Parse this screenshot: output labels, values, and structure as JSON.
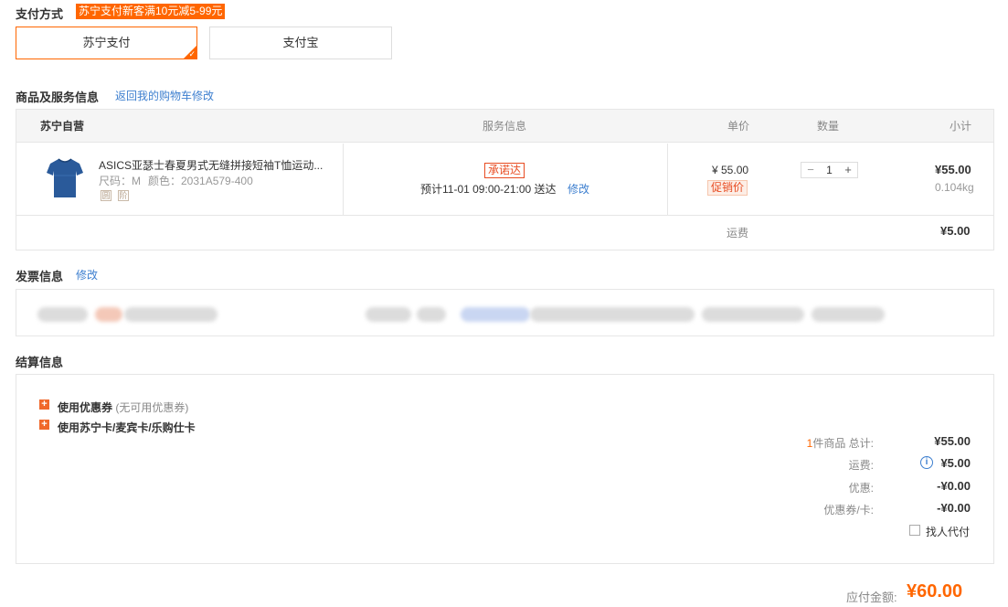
{
  "payment": {
    "title": "支付方式",
    "promo": "苏宁支付新客满10元减5-99元",
    "options": [
      {
        "label": "苏宁支付",
        "selected": true
      },
      {
        "label": "支付宝",
        "selected": false
      }
    ]
  },
  "goods": {
    "title": "商品及服务信息",
    "back_link": "返回我的购物车修改",
    "headers": {
      "store": "苏宁自营",
      "service": "服务信息",
      "unit_price": "单价",
      "quantity": "数量",
      "subtotal": "小计"
    },
    "item": {
      "name": "ASICS亚瑟士春夏男式无缝拼接短袖T恤运动...",
      "size": "尺码：M",
      "color": "颜色：2031A579-400",
      "icon1": "圆",
      "icon2": "阶",
      "service_tag": "承诺达",
      "delivery": "预计11-01 09:00-21:00 送达",
      "delivery_edit": "修改",
      "price": "¥ 55.00",
      "promo_tag": "促销价",
      "qty_minus": "−",
      "qty": "1",
      "qty_plus": "+",
      "subtotal": "¥55.00",
      "weight": "0.104kg"
    },
    "shipping_label": "运费",
    "shipping_value": "¥5.00"
  },
  "invoice": {
    "title": "发票信息",
    "edit": "修改"
  },
  "settlement": {
    "title": "结算信息",
    "coupon_label": "使用优惠券",
    "coupon_note": "(无可用优惠券)",
    "card_label": "使用苏宁卡/麦宾卡/乐购仕卡",
    "count": "1",
    "total_label": "件商品 总计:",
    "total_value": "¥55.00",
    "shipping_label": "运费:",
    "shipping_value": "¥5.00",
    "discount_label": "优惠:",
    "discount_value": "-¥0.00",
    "coupon_card_label": "优惠券/卡:",
    "coupon_card_value": "-¥0.00",
    "proxy_pay": "找人代付"
  },
  "payable": {
    "label": "应付金额:",
    "value": "¥60.00"
  },
  "colors": {
    "accent": "#ff6600",
    "link": "#3d7fcf",
    "tag": "#e84c22"
  }
}
